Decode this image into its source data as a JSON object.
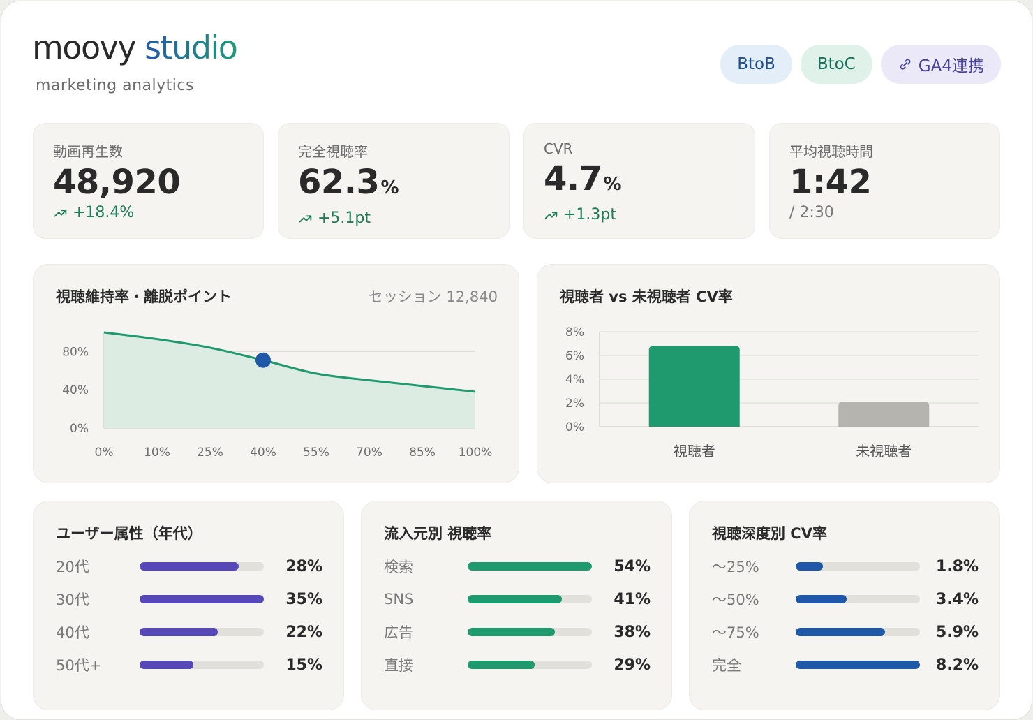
{
  "brand": {
    "word1": "moovy",
    "word2": "studio",
    "tagline": "marketing analytics"
  },
  "pills": [
    {
      "label": "BtoB"
    },
    {
      "label": "BtoC"
    },
    {
      "label": "GA4連携",
      "icon": "link-icon"
    }
  ],
  "kpis": [
    {
      "label": "動画再生数",
      "value": "48,920",
      "unit": "",
      "delta": "+18.4%",
      "trend": "up"
    },
    {
      "label": "完全視聴率",
      "value": "62.3",
      "unit": "%",
      "delta": "+5.1pt",
      "trend": "up"
    },
    {
      "label": "CVR",
      "value": "4.7",
      "unit": "%",
      "delta": "+1.3pt",
      "trend": "up"
    },
    {
      "label": "平均視聴時間",
      "value": "1:42",
      "unit": "",
      "sub": "/ 2:30"
    }
  ],
  "retention": {
    "title": "視聴維持率・離脱ポイント",
    "meta": "セッション 12,840"
  },
  "cv_compare": {
    "title": "視聴者 vs 未視聴者 CV率"
  },
  "age": {
    "title": "ユーザー属性（年代）",
    "color": "#5648b8",
    "rows": [
      {
        "label": "20代",
        "value": "28%",
        "pct": 0.8
      },
      {
        "label": "30代",
        "value": "35%",
        "pct": 1.0
      },
      {
        "label": "40代",
        "value": "22%",
        "pct": 0.63
      },
      {
        "label": "50代+",
        "value": "15%",
        "pct": 0.43
      }
    ]
  },
  "source": {
    "title": "流入元別 視聴率",
    "color": "#1f9a6f",
    "rows": [
      {
        "label": "検索",
        "value": "54%",
        "pct": 1.0
      },
      {
        "label": "SNS",
        "value": "41%",
        "pct": 0.76
      },
      {
        "label": "広告",
        "value": "38%",
        "pct": 0.7
      },
      {
        "label": "直接",
        "value": "29%",
        "pct": 0.54
      }
    ]
  },
  "depth": {
    "title": "視聴深度別 CV率",
    "color": "#1f58a8",
    "rows": [
      {
        "label": "〜25%",
        "value": "1.8%",
        "pct": 0.22
      },
      {
        "label": "〜50%",
        "value": "3.4%",
        "pct": 0.41
      },
      {
        "label": "〜75%",
        "value": "5.9%",
        "pct": 0.72
      },
      {
        "label": "完全",
        "value": "8.2%",
        "pct": 1.0
      }
    ]
  },
  "chart_data": [
    {
      "type": "area",
      "x": [
        "0%",
        "10%",
        "25%",
        "40%",
        "55%",
        "70%",
        "85%",
        "100%"
      ],
      "series": [
        {
          "values": [
            100,
            93,
            84,
            71,
            57,
            50,
            44,
            38
          ]
        }
      ],
      "highlight": {
        "x": "40%",
        "y": 71
      },
      "ylim": [
        0,
        100
      ],
      "yticks": [
        "0%",
        "40%",
        "80%"
      ],
      "ytick_values": [
        0,
        40,
        80
      ],
      "colors": {
        "line": "#1f9a6f",
        "fill": "#dcece3",
        "highlight": "#1f58a8"
      }
    },
    {
      "type": "bar",
      "categories": [
        "視聴者",
        "未視聴者"
      ],
      "values": [
        6.8,
        2.1
      ],
      "ylim": [
        0,
        8
      ],
      "yticks": [
        "0%",
        "2%",
        "4%",
        "6%",
        "8%"
      ],
      "ytick_values": [
        0,
        2,
        4,
        6,
        8
      ],
      "colors": [
        "#1f9a6f",
        "#b6b4ae"
      ]
    }
  ]
}
